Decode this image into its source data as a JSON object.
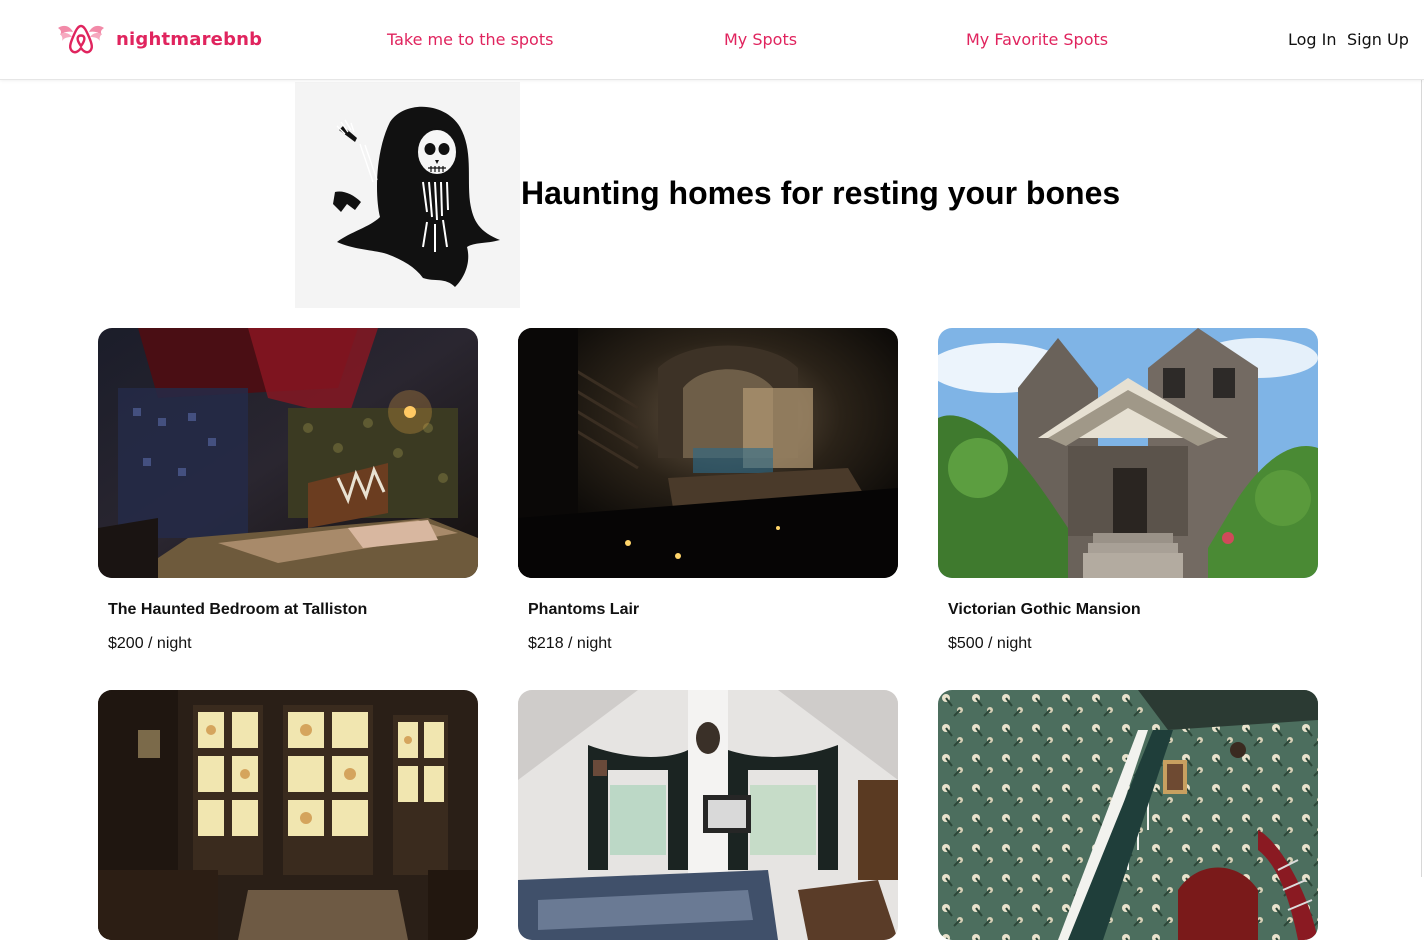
{
  "brand": {
    "name": "nightmarebnb",
    "logo_icon": "winged-airbnb-logo-icon",
    "color": "#e0245e"
  },
  "nav": {
    "links": [
      {
        "label": "Take me to the spots"
      },
      {
        "label": "My Spots"
      },
      {
        "label": "My Favorite Spots"
      }
    ],
    "login_label": "Log In",
    "signup_label": "Sign Up"
  },
  "hero": {
    "image": "grim-reaper-illustration",
    "title": "Haunting homes for resting your bones"
  },
  "spots": [
    {
      "name": "The Haunted Bedroom at Talliston",
      "price": "$200 / night",
      "image": "dark-ornate-bedroom-photo"
    },
    {
      "name": "Phantoms Lair",
      "price": "$218 / night",
      "image": "dim-stone-lair-photo"
    },
    {
      "name": "Victorian Gothic Mansion",
      "price": "$500 / night",
      "image": "gothic-mansion-porch-photo"
    },
    {
      "name": "",
      "price": "",
      "image": "stained-glass-room-photo"
    },
    {
      "name": "",
      "price": "",
      "image": "attic-bedroom-photo"
    },
    {
      "name": "",
      "price": "",
      "image": "floral-wallpaper-staircase-photo"
    }
  ]
}
